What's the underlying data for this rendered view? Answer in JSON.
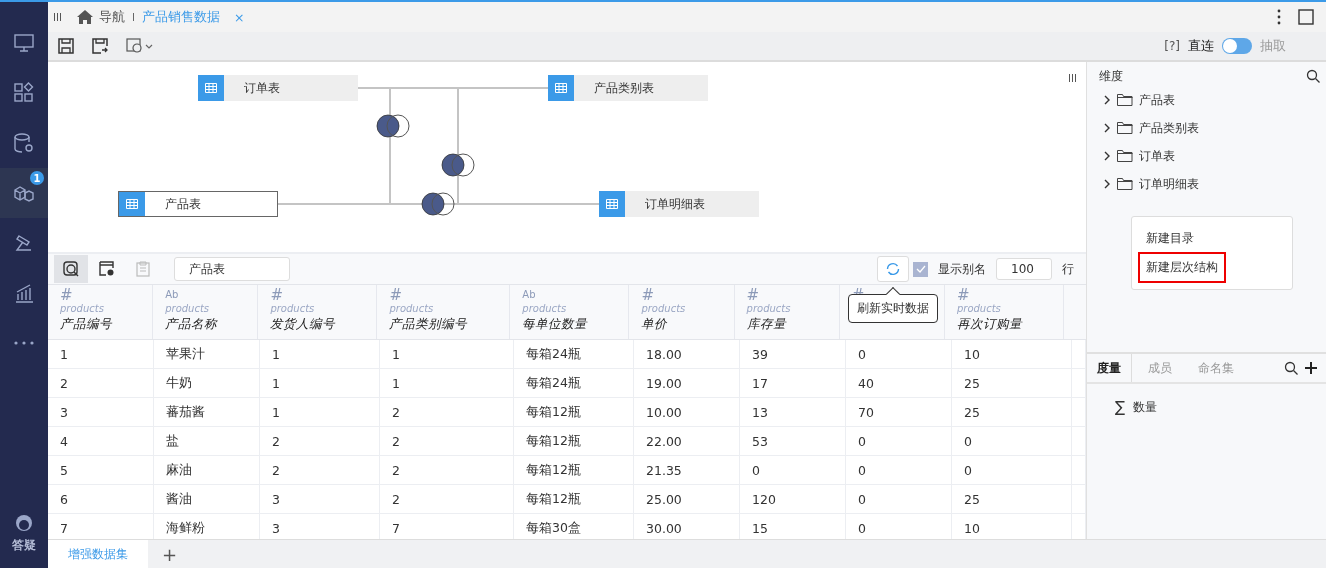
{
  "sidebar": {
    "items": [
      {
        "selected": false
      },
      {
        "selected": false
      },
      {
        "selected": false
      },
      {
        "selected": true,
        "badge": "1"
      },
      {
        "selected": false
      },
      {
        "selected": false
      },
      {
        "selected": false
      }
    ],
    "help_label": "答疑"
  },
  "tab_bar": {
    "nav_label": "导航",
    "tabs": [
      {
        "label": "产品销售数据",
        "selected": true,
        "close": "×"
      }
    ]
  },
  "toolbar": {
    "help": "[?]",
    "modes": [
      {
        "label": "直连",
        "selected": true
      },
      {
        "label": "抽取",
        "selected": false
      }
    ]
  },
  "diagram": {
    "tables": [
      {
        "name": "订单表",
        "selected": false
      },
      {
        "name": "产品类别表",
        "selected": false
      },
      {
        "name": "产品表",
        "selected": true
      },
      {
        "name": "订单明细表",
        "selected": false
      }
    ]
  },
  "preview": {
    "table_field": "产品表",
    "refresh_tooltip": "刷新实时数据",
    "show_alias": {
      "label": "显示别名",
      "checked": true
    },
    "row_count": "100",
    "row_unit": "行",
    "columns": [
      {
        "kind": "number",
        "type_mark": "#",
        "source": "products",
        "label": "产品编号"
      },
      {
        "kind": "text",
        "type_mark": "Ab",
        "source": "products",
        "label": "产品名称"
      },
      {
        "kind": "number",
        "type_mark": "#",
        "source": "products",
        "label": "发货人编号"
      },
      {
        "kind": "number",
        "type_mark": "#",
        "source": "products",
        "label": "产品类别编号"
      },
      {
        "kind": "text",
        "type_mark": "Ab",
        "source": "products",
        "label": "每单位数量"
      },
      {
        "kind": "number",
        "type_mark": "#",
        "source": "products",
        "label": "单价"
      },
      {
        "kind": "number",
        "type_mark": "#",
        "source": "products",
        "label": "库存量"
      },
      {
        "kind": "number",
        "type_mark": "#"
      },
      {
        "kind": "number",
        "type_mark": "#",
        "source": "products",
        "label": "再次订购量"
      }
    ],
    "rows": [
      [
        "1",
        "苹果汁",
        "1",
        "1",
        "每箱24瓶",
        "18.00",
        "39",
        "0",
        "10"
      ],
      [
        "2",
        "牛奶",
        "1",
        "1",
        "每箱24瓶",
        "19.00",
        "17",
        "40",
        "25"
      ],
      [
        "3",
        "蕃茄酱",
        "1",
        "2",
        "每箱12瓶",
        "10.00",
        "13",
        "70",
        "25"
      ],
      [
        "4",
        "盐",
        "2",
        "2",
        "每箱12瓶",
        "22.00",
        "53",
        "0",
        "0"
      ],
      [
        "5",
        "麻油",
        "2",
        "2",
        "每箱12瓶",
        "21.35",
        "0",
        "0",
        "0"
      ],
      [
        "6",
        "酱油",
        "3",
        "2",
        "每箱12瓶",
        "25.00",
        "120",
        "0",
        "25"
      ],
      [
        "7",
        "海鲜粉",
        "3",
        "7",
        "每箱30盒",
        "30.00",
        "15",
        "0",
        "10"
      ]
    ]
  },
  "dimensions": {
    "title": "维度",
    "folders": [
      {
        "name": "产品表",
        "expanded": false
      },
      {
        "name": "产品类别表",
        "expanded": false
      },
      {
        "name": "订单表",
        "expanded": false
      },
      {
        "name": "订单明细表",
        "expanded": false
      }
    ],
    "context_menu": [
      {
        "label": "新建目录",
        "highlighted": false
      },
      {
        "label": "新建层次结构",
        "highlighted": true
      }
    ]
  },
  "measures": {
    "tabs": [
      {
        "label": "度量",
        "selected": true
      },
      {
        "label": "成员",
        "selected": false
      },
      {
        "label": "命名集",
        "selected": false
      }
    ],
    "items": [
      {
        "symbol": "∑",
        "name": "数量"
      }
    ]
  },
  "bottom_tabs": {
    "tabs": [
      {
        "label": "增强数据集",
        "selected": true
      }
    ],
    "add": "+"
  }
}
